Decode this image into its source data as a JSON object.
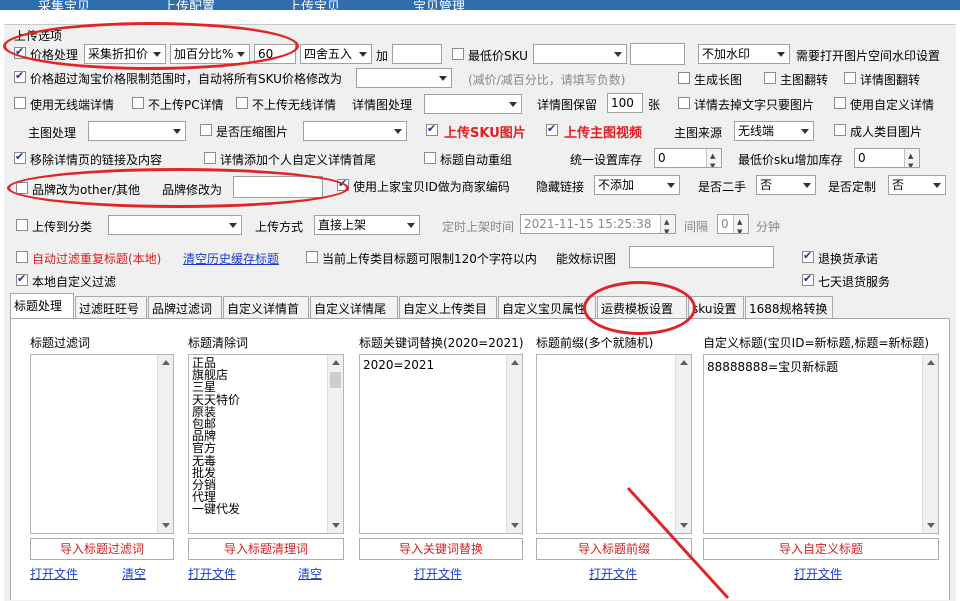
{
  "top_tabs": [
    "采集宝贝",
    "上传配置",
    "上传宝贝",
    "宝贝管理"
  ],
  "section_title": "上传选项",
  "row1": {
    "price_label": "价格处理",
    "price_mode": "采集折扣价",
    "price_method": "加百分比%",
    "price_value": "60",
    "rounding": "四舍五入",
    "add_label": "加",
    "add_value": "",
    "min_sku_label": "最低价SKU",
    "min_sku_select": "",
    "min_sku_value": "",
    "watermark": "不加水印",
    "watermark_note": "需要打开图片空间水印设置"
  },
  "row2": {
    "label": "价格超过淘宝价格限制范围时，自动将所有SKU价格修改为",
    "select": "",
    "hint": "(减价/减百分比，请填写负数)",
    "long_image": "生成长图",
    "main_flip": "主图翻转",
    "detail_flip": "详情图翻转"
  },
  "row3": {
    "wireless": "使用无线端详情",
    "no_pc": "不上传PC详情",
    "no_wireless": "不上传无线详情",
    "detail_proc": "详情图处理",
    "detail_keep": "详情图保留",
    "detail_keep_value": "100",
    "detail_keep_unit": "张",
    "detail_remove": "详情去掉文字只要图片",
    "custom_detail": "使用自定义详情"
  },
  "row4": {
    "main_proc": "主图处理",
    "compress": "是否压缩图片",
    "upload_sku_img": "上传SKU图片",
    "upload_main_video": "上传主图视频",
    "main_source_label": "主图来源",
    "main_source": "无线端",
    "adult": "成人类目图片"
  },
  "row5": {
    "remove_links": "移除详情页的链接及内容",
    "add_custom_head": "详情添加个人自定义详情首尾",
    "title_regroup": "标题自动重组",
    "stock_label": "统一设置库存",
    "stock_value": "0",
    "min_sku_add_label": "最低价sku增加库存",
    "min_sku_add_value": "0"
  },
  "row6": {
    "brand_other": "品牌改为other/其他",
    "brand_edit_label": "品牌修改为",
    "brand_value": "",
    "use_prev_id": "使用上家宝贝ID做为商家编码",
    "hide_link_label": "隐藏链接",
    "hide_link": "不添加",
    "second_hand_label": "是否二手",
    "second_hand": "否",
    "custom_label": "是否定制",
    "custom": "否"
  },
  "row7": {
    "upload_category": "上传到分类",
    "upload_method_label": "上传方式",
    "upload_method": "直接上架",
    "scheduled_label": "定时上架时间",
    "scheduled_time": "2021-11-15 15:25:38",
    "interval_label": "间隔",
    "interval_value": "0",
    "interval_unit": "分钟"
  },
  "row8": {
    "auto_filter": "自动过滤重复标题(本地)",
    "clear_cache": "清空历史缓存标题",
    "limit_120": "当前上传类目标题可限制120个字符以内",
    "efficacy_label": "能效标识图",
    "efficacy_value": "",
    "return_promise": "退换货承诺"
  },
  "row9": {
    "local_filter": "本地自定义过滤",
    "seven_day": "七天退货服务"
  },
  "sub_tabs": [
    "标题处理",
    "过滤旺旺号",
    "品牌过滤词",
    "自定义详情首",
    "自定义详情尾",
    "自定义上传类目",
    "自定义宝贝属性",
    "运费模板设置",
    "sku设置",
    "1688规格转换"
  ],
  "columns": [
    {
      "title": "标题过滤词",
      "content": [],
      "button": "导入标题过滤词",
      "open": "打开文件",
      "clear": "清空"
    },
    {
      "title": "标题清除词",
      "content": [
        "正品",
        "旗舰店",
        "三星",
        "天天特价",
        "原装",
        "包邮",
        "品牌",
        "官方",
        "无毒",
        "批发",
        "分销",
        "代理",
        "一键代发"
      ],
      "button": "导入标题清理词",
      "open": "打开文件",
      "clear": "清空"
    },
    {
      "title": "标题关键词替换(2020=2021)",
      "content": [
        "2020=2021"
      ],
      "button": "导入关键词替换",
      "open": "打开文件"
    },
    {
      "title": "标题前缀(多个就随机)",
      "content": [],
      "button": "导入标题前缀",
      "open": "打开文件"
    },
    {
      "title": "自定义标题(宝贝ID=新标题,标题=新标题)",
      "content": [
        "88888888=宝贝新标题"
      ],
      "button": "导入自定义标题",
      "open": "打开文件"
    }
  ],
  "colors": {
    "accent": "#2f6fb0",
    "annotation": "#e02525",
    "red_text": "#d42020",
    "link": "#1a3dc8"
  }
}
